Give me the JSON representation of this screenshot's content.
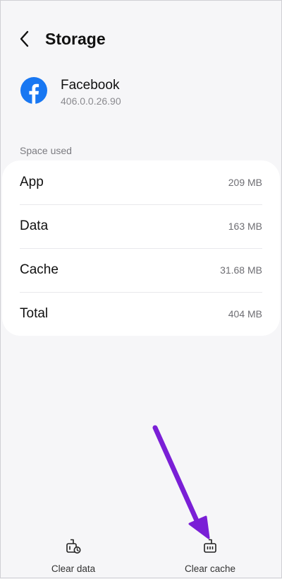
{
  "header": {
    "title": "Storage",
    "back_icon": "chevron-left-icon"
  },
  "app": {
    "name": "Facebook",
    "version": "406.0.0.26.90",
    "icon": "facebook-icon",
    "brand_color": "#1877f2"
  },
  "storage": {
    "section_label": "Space used",
    "rows": [
      {
        "label": "App",
        "value": "209 MB"
      },
      {
        "label": "Data",
        "value": "163 MB"
      },
      {
        "label": "Cache",
        "value": "31.68 MB"
      },
      {
        "label": "Total",
        "value": "404 MB"
      }
    ]
  },
  "actions": {
    "clear_data_label": "Clear data",
    "clear_data_icon": "clear-data-icon",
    "clear_cache_label": "Clear cache",
    "clear_cache_icon": "clear-cache-icon"
  },
  "annotation": {
    "arrow_icon": "annotation-arrow",
    "arrow_color": "#7a1fd6"
  }
}
